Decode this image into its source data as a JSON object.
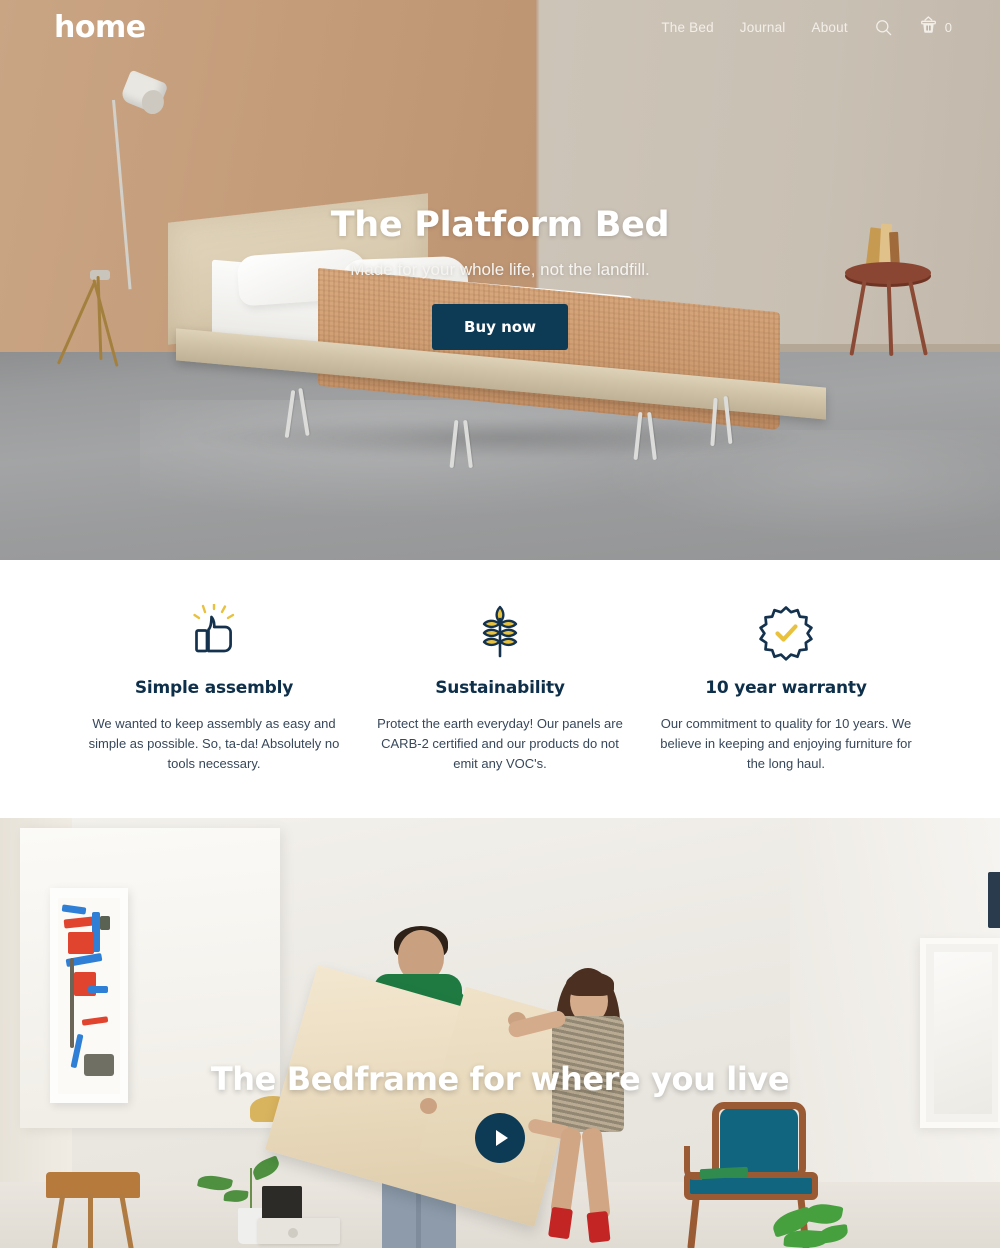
{
  "nav": {
    "logo": "home",
    "links": [
      {
        "label": "The Bed"
      },
      {
        "label": "Journal"
      },
      {
        "label": "About"
      }
    ],
    "search_icon": "search-icon",
    "cart_icon": "shopping-basket-icon",
    "cart_count": "0"
  },
  "hero": {
    "title": "The Platform Bed",
    "subtitle": "Made for your whole life, not the landfill.",
    "cta_label": "Buy now"
  },
  "features": [
    {
      "icon": "thumbs-up-icon",
      "title": "Simple assembly",
      "text": "We wanted to keep assembly as easy and simple as possible. So, ta-da! Absolutely no tools necessary."
    },
    {
      "icon": "leaf-plant-icon",
      "title": "Sustainability",
      "text": "Protect the earth everyday! Our panels are CARB-2 certified and our products do not emit any VOC's."
    },
    {
      "icon": "badge-check-icon",
      "title": "10 year warranty",
      "text": "Our commitment to quality for 10 years. We believe in keeping and enjoying furniture for the long haul."
    }
  ],
  "video_section": {
    "title": "The Bedframe for where you live",
    "play_icon": "play-icon"
  },
  "colors": {
    "navy": "#0d3a54",
    "heading_navy": "#0e2f4a",
    "body_text": "#37475a",
    "accent_yellow": "#e8c13f",
    "white": "#ffffff"
  }
}
